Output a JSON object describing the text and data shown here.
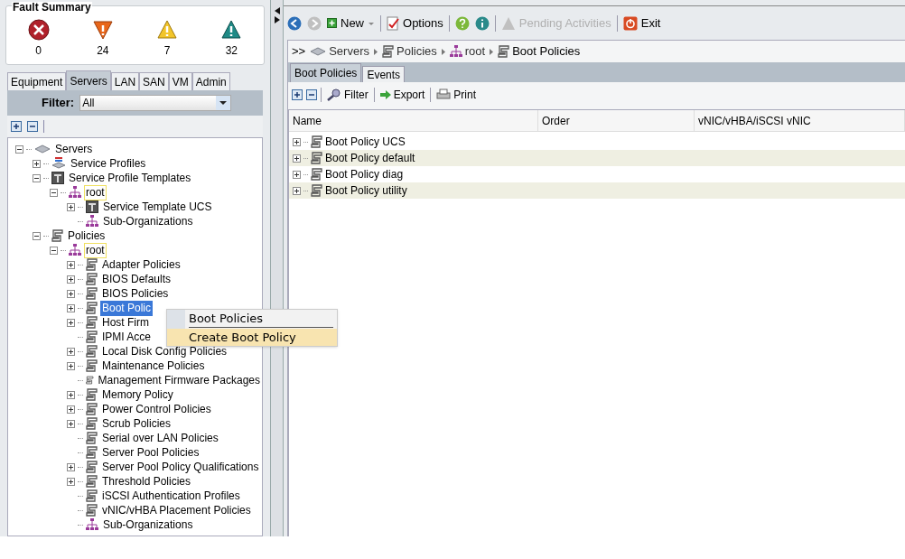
{
  "fault_summary": {
    "title": "Fault Summary",
    "faults": [
      {
        "kind": "critical",
        "count": "0"
      },
      {
        "kind": "major",
        "count": "24"
      },
      {
        "kind": "minor",
        "count": "7"
      },
      {
        "kind": "warning",
        "count": "32"
      }
    ]
  },
  "nav_tabs": [
    {
      "label": "Equipment",
      "selected": false
    },
    {
      "label": "Servers",
      "selected": true
    },
    {
      "label": "LAN",
      "selected": false
    },
    {
      "label": "SAN",
      "selected": false
    },
    {
      "label": "VM",
      "selected": false
    },
    {
      "label": "Admin",
      "selected": false
    }
  ],
  "filter": {
    "label": "Filter:",
    "value": "All"
  },
  "tree": [
    {
      "label": "Servers",
      "kind": "servers",
      "expanded": true,
      "selected": false,
      "outlined": false,
      "children": [
        {
          "label": "Service Profiles",
          "kind": "profiles",
          "expanded": false,
          "selected": false,
          "outlined": false
        },
        {
          "label": "Service Profile Templates",
          "kind": "template",
          "expanded": true,
          "selected": false,
          "outlined": false,
          "children": [
            {
              "label": "root",
              "kind": "org",
              "expanded": true,
              "selected": false,
              "outlined": true,
              "children": [
                {
                  "label": "Service Template UCS",
                  "kind": "template",
                  "expanded": false,
                  "selected": false,
                  "outlined": false
                },
                {
                  "label": "Sub-Organizations",
                  "kind": "org",
                  "selected": false,
                  "outlined": false
                }
              ]
            }
          ]
        },
        {
          "label": "Policies",
          "kind": "policy",
          "expanded": true,
          "selected": false,
          "outlined": false,
          "children": [
            {
              "label": "root",
              "kind": "org",
              "expanded": true,
              "selected": false,
              "outlined": true,
              "children": [
                {
                  "label": "Adapter Policies",
                  "kind": "policy",
                  "expanded": false,
                  "selected": false,
                  "outlined": false
                },
                {
                  "label": "BIOS Defaults",
                  "kind": "policy",
                  "expanded": false,
                  "selected": false,
                  "outlined": false
                },
                {
                  "label": "BIOS Policies",
                  "kind": "policy",
                  "expanded": false,
                  "selected": false,
                  "outlined": false
                },
                {
                  "label": "Boot Polic",
                  "kind": "policy",
                  "expanded": false,
                  "selected": true,
                  "outlined": false
                },
                {
                  "label": "Host Firm",
                  "kind": "policy",
                  "expanded": false,
                  "selected": false,
                  "outlined": false
                },
                {
                  "label": "IPMI Acce",
                  "kind": "policy",
                  "selected": false,
                  "outlined": false
                },
                {
                  "label": "Local Disk Config Policies",
                  "kind": "policy",
                  "expanded": false,
                  "selected": false,
                  "outlined": false
                },
                {
                  "label": "Maintenance Policies",
                  "kind": "policy",
                  "expanded": false,
                  "selected": false,
                  "outlined": false
                },
                {
                  "label": "Management Firmware Packages",
                  "kind": "policy",
                  "selected": false,
                  "outlined": false
                },
                {
                  "label": "Memory Policy",
                  "kind": "policy",
                  "expanded": false,
                  "selected": false,
                  "outlined": false
                },
                {
                  "label": "Power Control Policies",
                  "kind": "policy",
                  "expanded": false,
                  "selected": false,
                  "outlined": false
                },
                {
                  "label": "Scrub Policies",
                  "kind": "policy",
                  "expanded": false,
                  "selected": false,
                  "outlined": false
                },
                {
                  "label": "Serial over LAN Policies",
                  "kind": "policy",
                  "selected": false,
                  "outlined": false
                },
                {
                  "label": "Server Pool Policies",
                  "kind": "policy",
                  "selected": false,
                  "outlined": false
                },
                {
                  "label": "Server Pool Policy Qualifications",
                  "kind": "policy",
                  "expanded": false,
                  "selected": false,
                  "outlined": false
                },
                {
                  "label": "Threshold Policies",
                  "kind": "policy",
                  "expanded": false,
                  "selected": false,
                  "outlined": false
                },
                {
                  "label": "iSCSI Authentication Profiles",
                  "kind": "policy",
                  "selected": false,
                  "outlined": false
                },
                {
                  "label": "vNIC/vHBA Placement Policies",
                  "kind": "policy",
                  "selected": false,
                  "outlined": false
                },
                {
                  "label": "Sub-Organizations",
                  "kind": "org",
                  "selected": false,
                  "outlined": false
                }
              ]
            }
          ]
        }
      ]
    }
  ],
  "context_menu": {
    "title": "Boot Policies",
    "items": [
      {
        "label": "Create Boot Policy",
        "selected": true
      }
    ]
  },
  "toolbar": [
    {
      "kind": "back",
      "disabled": false
    },
    {
      "kind": "forward",
      "disabled": true
    },
    {
      "kind": "new",
      "label": "New",
      "disabled": false
    },
    {
      "kind": "options",
      "label": "Options",
      "disabled": false
    },
    {
      "kind": "help",
      "disabled": false
    },
    {
      "kind": "info",
      "disabled": false
    },
    {
      "kind": "pending",
      "label": "Pending Activities",
      "disabled": true
    },
    {
      "kind": "exit",
      "label": "Exit",
      "disabled": false
    }
  ],
  "breadcrumb": {
    "prefix": ">>",
    "items": [
      {
        "label": "Servers",
        "kind": "servers"
      },
      {
        "label": "Policies",
        "kind": "policy"
      },
      {
        "label": "root",
        "kind": "org"
      },
      {
        "label": "Boot Policies",
        "kind": "policy"
      }
    ]
  },
  "content_tabs": [
    {
      "label": "Boot Policies",
      "selected": true
    },
    {
      "label": "Events",
      "selected": false
    }
  ],
  "table_toolbar": [
    {
      "kind": "add"
    },
    {
      "kind": "remove"
    },
    {
      "kind": "filter",
      "label": "Filter"
    },
    {
      "kind": "export",
      "label": "Export"
    },
    {
      "kind": "print",
      "label": "Print"
    }
  ],
  "table": {
    "columns": [
      "Name",
      "Order",
      "vNIC/vHBA/iSCSI vNIC"
    ],
    "rows": [
      {
        "name": "Boot Policy UCS",
        "expanded": false
      },
      {
        "name": "Boot Policy default",
        "expanded": false
      },
      {
        "name": "Boot Policy diag",
        "expanded": false
      },
      {
        "name": "Boot Policy utility",
        "expanded": false
      }
    ]
  }
}
